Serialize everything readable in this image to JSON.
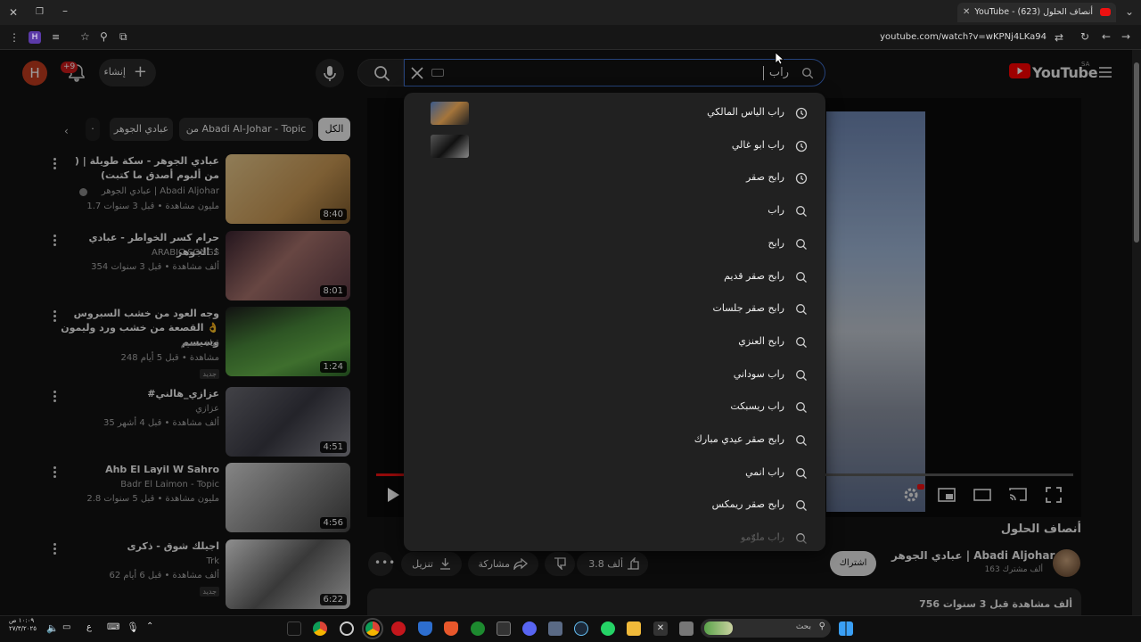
{
  "browser": {
    "tab_title": "YouTube - (623) أنصاف الحلول",
    "url": "youtube.com/watch?v=wKPNj4LKa94"
  },
  "masthead": {
    "avatar_letter": "H",
    "notification_badge": "+9",
    "create_label": "إنشاء",
    "search_query": "راب",
    "logo_text": "YouTube",
    "logo_region": "SA"
  },
  "chips": [
    {
      "label": "الكل",
      "active": true
    },
    {
      "label": "من Abadi Al-Johar - Topic",
      "active": false
    },
    {
      "label": "عبادي الجوهر",
      "active": false
    }
  ],
  "related": [
    {
      "title": "عبادي الجوهر - سكة طويلة | ( من ألبوم أصدق ما كتبت)",
      "channel": "عبادي الجوهر | Abadi Aljohar",
      "verified": true,
      "meta": "1.7 مليون مشاهدة • قبل 3 سنوات",
      "duration": "8:40",
      "badge": ""
    },
    {
      "title": "حرام كسر الخواطر - عبادي الجوهر ♪",
      "channel": "ARABIC SONGS",
      "verified": false,
      "meta": "354 ألف مشاهدة • قبل 3 سنوات",
      "duration": "8:01",
      "badge": ""
    },
    {
      "title": "وجه العود من خشب السبروس 👌 القصعة من خشب ورد وليمون وسيسم",
      "channel": "قناة صميم",
      "verified": false,
      "meta": "248 مشاهدة • قبل 5 أيام",
      "duration": "1:24",
      "badge": "جديد"
    },
    {
      "title": "#عزازي_هالني",
      "channel": "عزازي",
      "verified": false,
      "meta": "35 ألف مشاهدة • قبل 4 أشهر",
      "duration": "4:51",
      "badge": ""
    },
    {
      "title": "Ahb El Layil W Sahro",
      "channel": "Badr El Laimon - Topic",
      "verified": false,
      "meta": "2.8 مليون مشاهدة • قبل 5 سنوات",
      "duration": "4:56",
      "badge": ""
    },
    {
      "title": "اجيلك شوق - ذكرى",
      "channel": "Trk",
      "verified": false,
      "meta": "62 ألف مشاهدة • قبل 6 أيام",
      "duration": "6:22",
      "badge": "جديد"
    }
  ],
  "suggestions": [
    {
      "label": "راب الياس المالكي",
      "icon": "history-icon",
      "thumb": true
    },
    {
      "label": "راب ابو غالي",
      "icon": "history-icon",
      "thumb": true
    },
    {
      "label": "رابح صقر",
      "icon": "history-icon",
      "thumb": false
    },
    {
      "label": "راب",
      "icon": "search-icon",
      "thumb": false
    },
    {
      "label": "رابح",
      "icon": "search-icon",
      "thumb": false
    },
    {
      "label": "رابح صقر قديم",
      "icon": "search-icon",
      "thumb": false
    },
    {
      "label": "رابح صقر جلسات",
      "icon": "search-icon",
      "thumb": false
    },
    {
      "label": "رابح العنزي",
      "icon": "search-icon",
      "thumb": false
    },
    {
      "label": "راب سوداني",
      "icon": "search-icon",
      "thumb": false
    },
    {
      "label": "راب ريسبكت",
      "icon": "search-icon",
      "thumb": false
    },
    {
      "label": "رابح صقر عيدي مبارك",
      "icon": "search-icon",
      "thumb": false
    },
    {
      "label": "راب انمي",
      "icon": "search-icon",
      "thumb": false
    },
    {
      "label": "رابح صقر ريمكس",
      "icon": "search-icon",
      "thumb": false
    },
    {
      "label": "راب ملوّمو",
      "icon": "search-icon",
      "thumb": false
    }
  ],
  "video": {
    "title": "أنصاف الحلول",
    "channel_name": "عبادي الجوهر | Abadi Aljohar",
    "subscribers": "163 ألف مشترك",
    "subscribe_label": "اشتراك",
    "likes": "3.8 ألف",
    "share_label": "مشاركة",
    "download_label": "تنزيل",
    "description_meta": "756 ألف مشاهدة  قبل 3 سنوات",
    "progress": 0.04
  },
  "taskbar": {
    "search_placeholder": "بحث",
    "time": "١٠:٠٩ ص",
    "date": "٢٧/٣/٢٠٢٥",
    "lang": "ع"
  },
  "colors": {
    "accent": "#3d6bc6",
    "brand_red": "#ff0000",
    "badge_red": "#cc1a1a"
  }
}
